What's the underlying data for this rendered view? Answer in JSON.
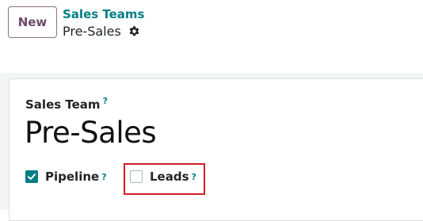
{
  "control_panel": {
    "new_button_label": "New",
    "breadcrumb_parent": "Sales Teams",
    "breadcrumb_current": "Pre-Sales",
    "settings_icon": "gear-icon"
  },
  "form": {
    "name_field_label": "Sales Team",
    "name_help": "?",
    "name_value": "Pre-Sales",
    "options": [
      {
        "label": "Pipeline",
        "help": "?",
        "checked": true
      },
      {
        "label": "Leads",
        "help": "?",
        "checked": false
      }
    ]
  },
  "colors": {
    "accent": "#017e84",
    "highlight": "#d01f26",
    "new_button_text": "#6b4b68"
  }
}
